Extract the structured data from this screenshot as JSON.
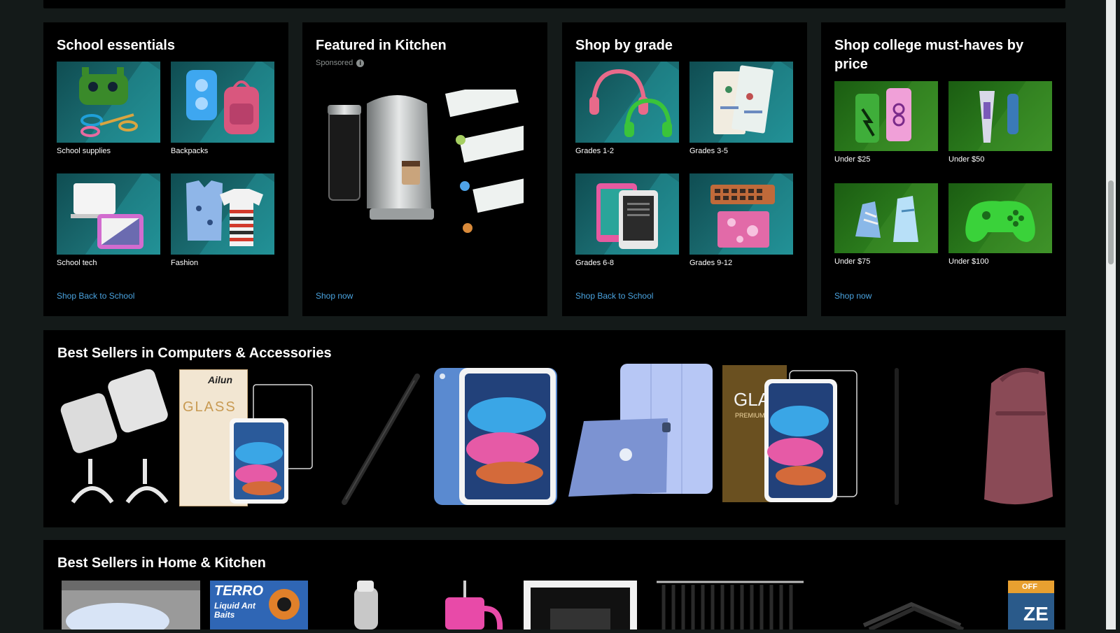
{
  "cards": [
    {
      "title": "School essentials",
      "tiles": [
        "School supplies",
        "Backpacks",
        "School tech",
        "Fashion"
      ],
      "link": "Shop Back to School"
    },
    {
      "title": "Featured in Kitchen",
      "sponsored": "Sponsored",
      "info_icon": "i",
      "link": "Shop now"
    },
    {
      "title": "Shop by grade",
      "tiles": [
        "Grades 1-2",
        "Grades 3-5",
        "Grades 6-8",
        "Grades 9-12"
      ],
      "link": "Shop Back to School"
    },
    {
      "title": "Shop college must-haves by price",
      "tiles": [
        "Under $25",
        "Under $50",
        "Under $75",
        "Under $100"
      ],
      "link": "Shop now"
    }
  ],
  "best_sellers_computers": {
    "title": "Best Sellers in Computers & Accessories",
    "brand_ailun": "Ailun",
    "glass_text": "GLASS",
    "glass_text_2": "GLAS",
    "premium_text": "PREMIUM"
  },
  "best_sellers_home": {
    "title": "Best Sellers in Home & Kitchen",
    "terro_brand": "TERRO",
    "terro_product": "Liquid Ant Baits",
    "offer_text": "OFF",
    "ze_text": "ZE"
  },
  "colors": {
    "link": "#4aa3df",
    "card_bg": "#000000",
    "page_bg": "#141a19"
  }
}
